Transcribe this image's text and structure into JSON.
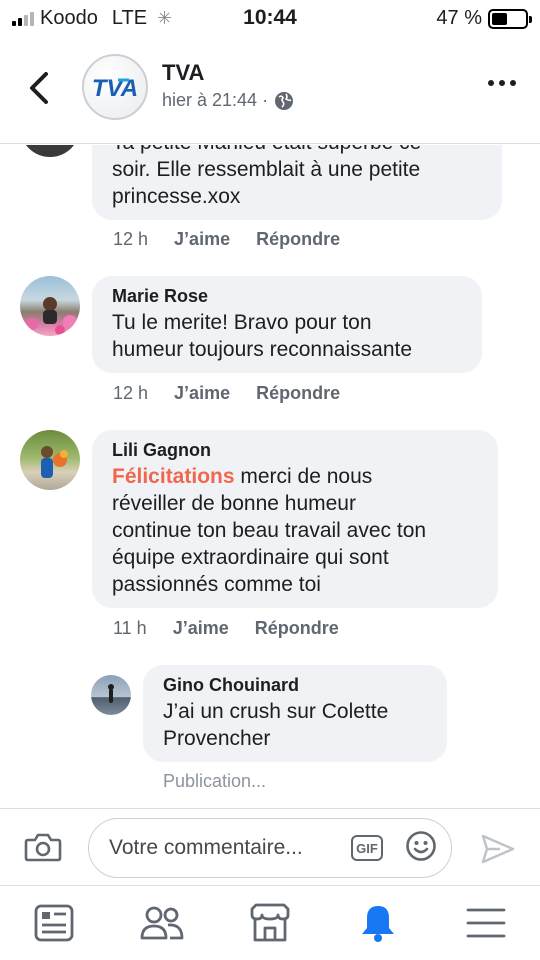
{
  "status_bar": {
    "carrier": "Koodo",
    "network": "LTE",
    "time": "10:44",
    "battery": "47 %",
    "battery_level": 0.47
  },
  "header": {
    "page_name": "TVA",
    "timestamp": "hier à 21:44 ·",
    "logo_text": "TVA"
  },
  "comments": [
    {
      "text": "Ta petite Manieu était superbe ce\nsoir. Elle ressemblait à une petite\nprincesse.xox",
      "age": "12 h",
      "like": "J’aime",
      "reply": "Répondre"
    },
    {
      "author": "Marie Rose",
      "text": "Tu le merite! Bravo pour ton\nhumeur toujours reconnaissante",
      "age": "12 h",
      "like": "J’aime",
      "reply": "Répondre"
    },
    {
      "author": "Lili Gagnon",
      "highlight": "Félicitations",
      "text": "  merci de nous\nréveiller de bonne  humeur\ncontinue ton beau travail avec ton\néquipe extraordinaire  qui sont\npassionnés comme  toi",
      "age": "11 h",
      "like": "J’aime",
      "reply": "Répondre"
    },
    {
      "author": "Gino Chouinard",
      "text": "J’ai un crush sur Colette\nProvencher",
      "status": "Publication..."
    }
  ],
  "composer": {
    "placeholder": "Votre commentaire...",
    "gif_label": "GIF"
  },
  "icons": {
    "back": "chevron-left-icon",
    "more": "more-icon",
    "globe": "globe-icon",
    "camera": "camera-icon",
    "emoji": "emoji-icon",
    "send": "send-icon",
    "tabs": [
      "news-feed-icon",
      "friends-icon",
      "marketplace-icon",
      "notifications-icon",
      "menu-icon"
    ]
  },
  "colors": {
    "accent": "#1877f2",
    "highlight": "#f0674d",
    "bubble": "#f0f2f5",
    "muted": "#606770"
  }
}
